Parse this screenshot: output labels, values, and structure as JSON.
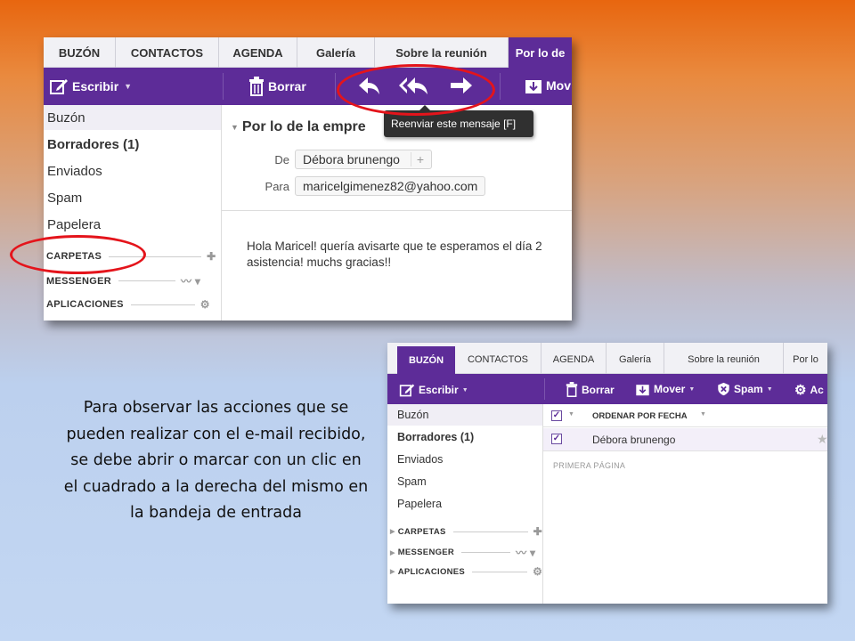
{
  "screenshot1": {
    "tabs": [
      "BUZÓN",
      "CONTACTOS",
      "AGENDA",
      "Galería",
      "Sobre la reunión",
      "Por lo de"
    ],
    "toolbar": {
      "compose": "Escribir",
      "delete": "Borrar",
      "move": "Mov"
    },
    "folders": [
      "Buzón",
      "Borradores (1)",
      "Enviados",
      "Spam",
      "Papelera"
    ],
    "sections": [
      "CARPETAS",
      "MESSENGER",
      "APLICACIONES"
    ],
    "message": {
      "subject": "Por lo de la empre",
      "from_label": "De",
      "from": "Débora brunengo",
      "to_label": "Para",
      "to": "maricelgimenez82@yahoo.com",
      "body_line1": "Hola Maricel! quería avisarte que te esperamos el día 2",
      "body_line2": "asistencia! muchs gracias!!"
    },
    "tooltip": "Reenviar este mensaje  [F]"
  },
  "screenshot2": {
    "tabs": [
      "BUZÓN",
      "CONTACTOS",
      "AGENDA",
      "Galería",
      "Sobre la reunión",
      "Por lo"
    ],
    "toolbar": {
      "compose": "Escribir",
      "delete": "Borrar",
      "move": "Mover",
      "spam": "Spam",
      "actions": "Ac"
    },
    "folders": [
      "Buzón",
      "Borradores (1)",
      "Enviados",
      "Spam",
      "Papelera"
    ],
    "sections": [
      "CARPETAS",
      "MESSENGER",
      "APLICACIONES"
    ],
    "list": {
      "sort_label": "ORDENAR POR FECHA",
      "sender": "Débora brunengo",
      "page_label": "PRIMERA PÁGINA"
    }
  },
  "caption": "Para observar las acciones que se pueden realizar con el e-mail recibido, se debe abrir o marcar con un clic en el cuadrado a la derecha del mismo en la bandeja de entrada",
  "colors": {
    "accent": "#5d2c98",
    "highlight": "#e4141b"
  }
}
